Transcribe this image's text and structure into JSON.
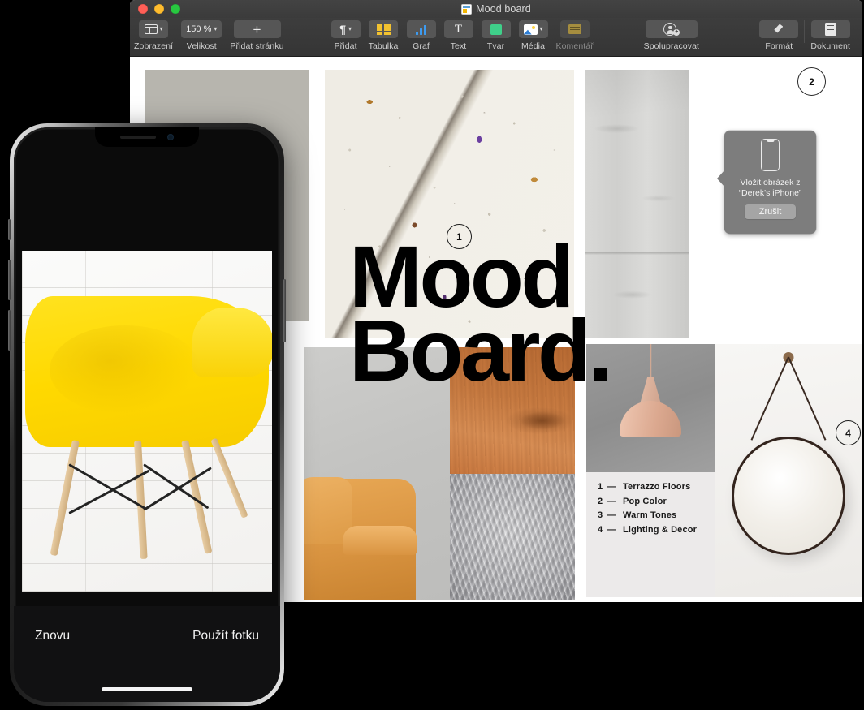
{
  "window": {
    "title": "Mood board",
    "doc_icon": "keynote-document-icon",
    "traffic_lights": [
      "close",
      "minimize",
      "zoom"
    ]
  },
  "toolbar": {
    "groups": [
      {
        "items": [
          {
            "label": "Zobrazení",
            "icon": "view-layout-icon",
            "has_chevron": true,
            "disabled": false
          },
          {
            "label": "Velikost",
            "icon": "zoom-level-icon",
            "value": "150 %",
            "has_chevron": true,
            "disabled": false
          },
          {
            "label": "Přidat stránku",
            "icon": "plus-icon",
            "has_chevron": false,
            "disabled": false
          }
        ]
      },
      {
        "items": [
          {
            "label": "Přidat",
            "icon": "pilcrow-icon",
            "has_chevron": true,
            "disabled": false
          },
          {
            "label": "Tabulka",
            "icon": "table-icon",
            "has_chevron": false,
            "disabled": false
          },
          {
            "label": "Graf",
            "icon": "bar-chart-icon",
            "has_chevron": false,
            "disabled": false
          },
          {
            "label": "Text",
            "icon": "text-icon",
            "has_chevron": false,
            "disabled": false
          },
          {
            "label": "Tvar",
            "icon": "shape-icon",
            "has_chevron": false,
            "disabled": false
          },
          {
            "label": "Média",
            "icon": "media-image-icon",
            "has_chevron": true,
            "disabled": false
          },
          {
            "label": "Komentář",
            "icon": "comment-icon",
            "has_chevron": false,
            "disabled": true
          }
        ]
      },
      {
        "items": [
          {
            "label": "Spolupracovat",
            "icon": "collaborate-add-person-icon",
            "has_chevron": false,
            "disabled": false
          }
        ]
      },
      {
        "items": [
          {
            "label": "Formát",
            "icon": "format-brush-icon",
            "has_chevron": false,
            "disabled": false
          },
          {
            "label": "Dokument",
            "icon": "document-icon",
            "has_chevron": false,
            "disabled": false
          }
        ]
      }
    ]
  },
  "document": {
    "heading_line1": "Mood",
    "heading_line2": "Board.",
    "legend": [
      {
        "num": "1",
        "dash": "—",
        "text": "Terrazzo Floors"
      },
      {
        "num": "2",
        "dash": "—",
        "text": "Pop Color"
      },
      {
        "num": "3",
        "dash": "—",
        "text": "Warm Tones"
      },
      {
        "num": "4",
        "dash": "—",
        "text": "Lighting & Decor"
      }
    ],
    "callouts": [
      {
        "id": "1",
        "label": "1"
      },
      {
        "id": "2",
        "label": "2"
      },
      {
        "id": "4",
        "label": "4"
      }
    ],
    "images": [
      {
        "name": "concrete-wall-photo"
      },
      {
        "name": "terrazzo-slab-photo"
      },
      {
        "name": "concrete-column-photo"
      },
      {
        "name": "leather-sofa-photo"
      },
      {
        "name": "wood-grain-photo"
      },
      {
        "name": "fur-rug-photo"
      },
      {
        "name": "pendant-lamp-photo"
      },
      {
        "name": "round-mirror-photo"
      }
    ]
  },
  "popup": {
    "icon": "iphone-device-icon",
    "line1": "Vložit obrázek z",
    "line2": "“Derek's iPhone”",
    "cancel_label": "Zrušit"
  },
  "phone": {
    "photo_name": "yellow-eames-chair-photo",
    "retake_label": "Znovu",
    "use_photo_label": "Použít fotku"
  },
  "colors": {
    "toolbar_bg": "#3a3a3a",
    "titlebar_bg": "#3e3e3e",
    "canvas_bg": "#ffffff",
    "popup_bg": "#7d7d7d",
    "accent_yellow": "#ffd900",
    "close_red": "#ff5f57",
    "minimize_yellow": "#febc2e",
    "zoom_green": "#28c840"
  }
}
